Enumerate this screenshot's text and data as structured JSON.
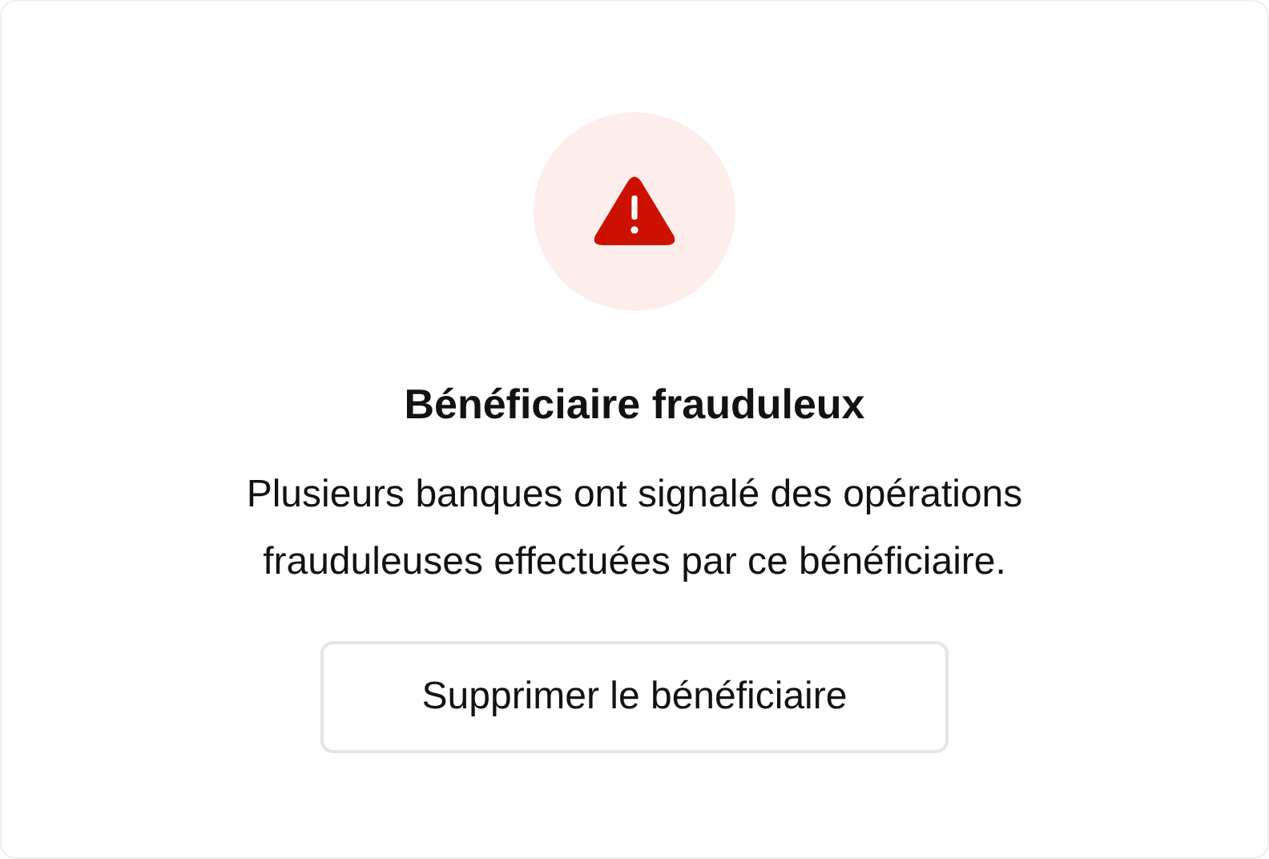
{
  "dialog": {
    "title": "Bénéficiaire frauduleux",
    "message": "Plusieurs banques ont signalé des opérations frauduleuses effectuées par ce bénéficiaire.",
    "button": "Supprimer le bénéficiaire"
  }
}
